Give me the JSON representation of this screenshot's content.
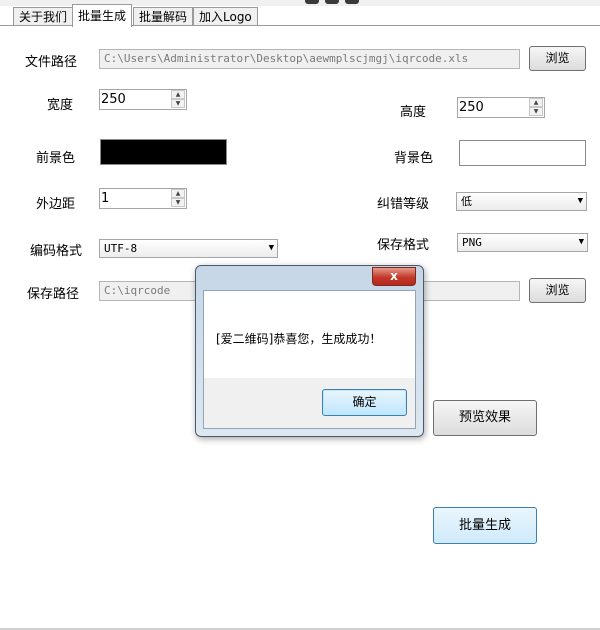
{
  "tabs": [
    {
      "label": "关于我们",
      "active": false
    },
    {
      "label": "批量生成",
      "active": true
    },
    {
      "label": "批量解码",
      "active": false
    },
    {
      "label": "加入Logo",
      "active": false
    }
  ],
  "form": {
    "file_path_label": "文件路径",
    "file_path_value": "C:\\Users\\Administrator\\Desktop\\aewmplscjmgj\\iqrcode.xls",
    "browse_label": "浏览",
    "width_label": "宽度",
    "width_value": "250",
    "height_label": "高度",
    "height_value": "250",
    "foreground_label": "前景色",
    "foreground_color": "#000000",
    "background_label": "背景色",
    "background_color": "#ffffff",
    "margin_label": "外边距",
    "margin_value": "1",
    "error_level_label": "纠错等级",
    "error_level_value": "低",
    "encoding_label": "编码格式",
    "encoding_value": "UTF-8",
    "save_format_label": "保存格式",
    "save_format_value": "PNG",
    "save_path_label": "保存路径",
    "save_path_value": "C:\\iqrcode",
    "browse2_label": "浏览",
    "preview_label": "预览效果",
    "generate_label": "批量生成"
  },
  "dialog": {
    "close_glyph": "x",
    "message": "[爱二维码]恭喜您，生成成功！",
    "ok_label": "确定"
  },
  "icons": {
    "spin_up": "▲",
    "spin_down": "▼",
    "dropdown": "▼"
  }
}
